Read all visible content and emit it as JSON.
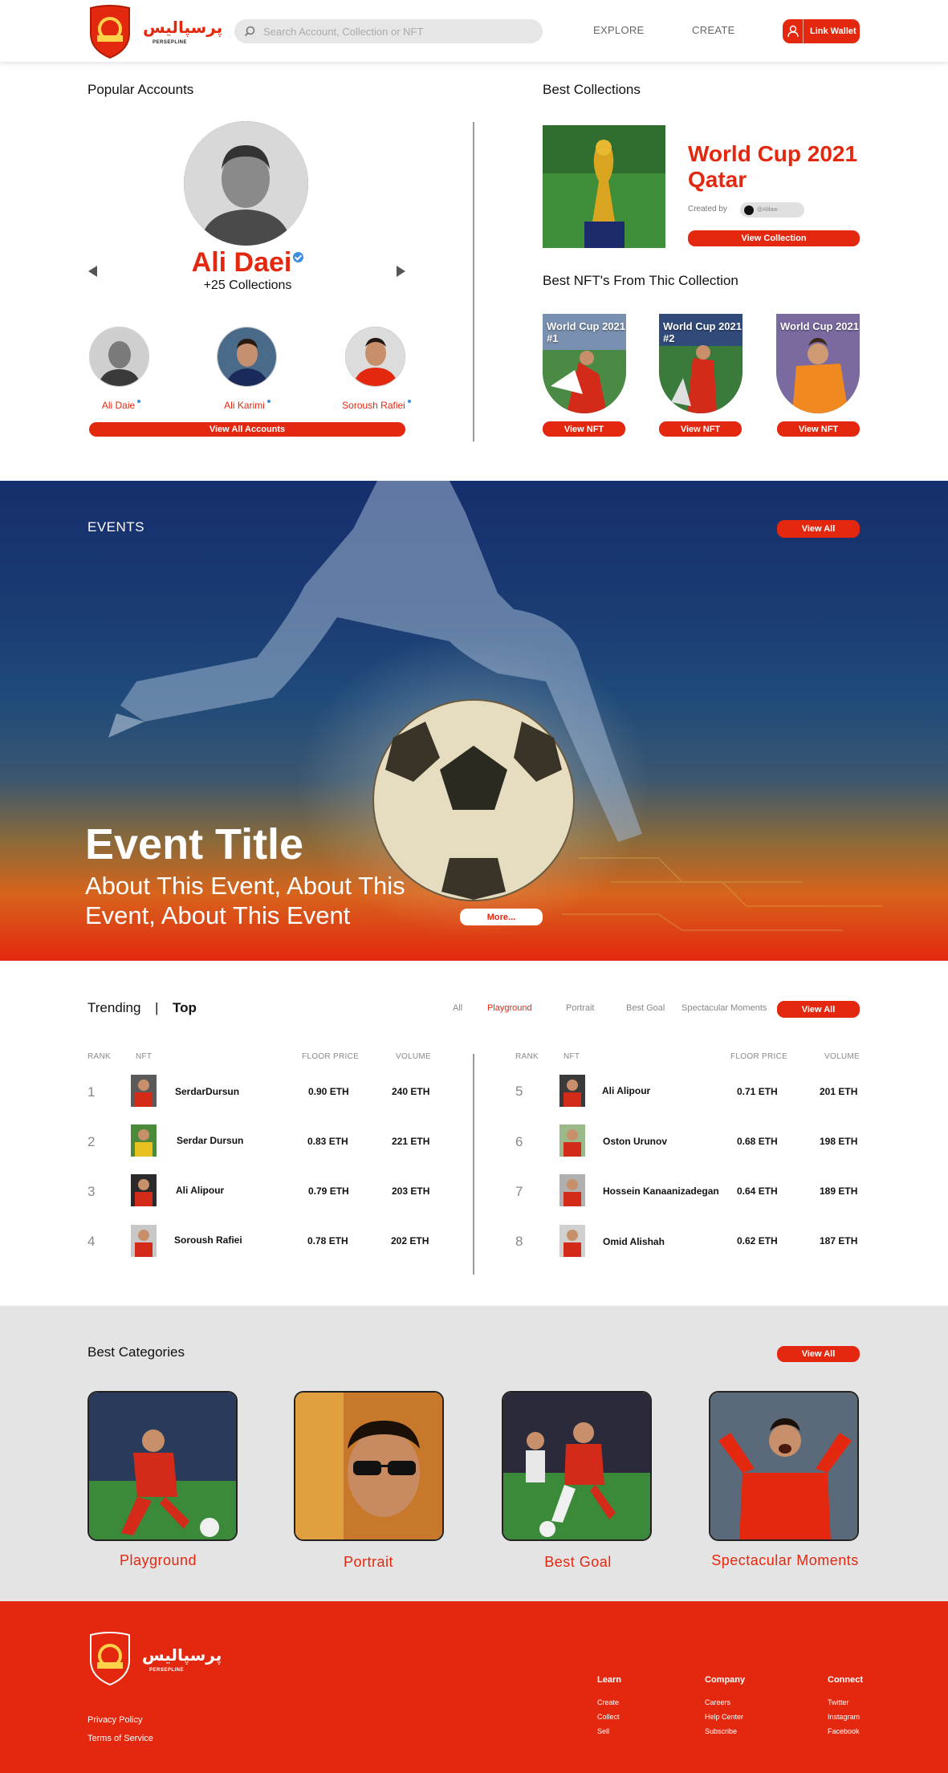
{
  "header": {
    "logo_text": "پرسپالیس",
    "logo_sub": "PERSEPLINE",
    "search_placeholder": "Search Account, Collection or NFT",
    "nav": [
      "EXPLORE",
      "CREATE"
    ],
    "wallet_label": "Link Wallet"
  },
  "popular": {
    "title": "Popular Accounts",
    "featured_name": "Ali Daei",
    "featured_collections": "+25 Collections",
    "accounts": [
      "Ali Daie",
      "Ali Karimi",
      "Soroush Rafiei"
    ],
    "view_all": "View All Accounts"
  },
  "collections": {
    "title": "Best Collections",
    "featured_title": "World Cup 2021 Qatar",
    "created_by": "Created by",
    "creator": "@Alilaw",
    "view_collection": "View Collection",
    "nft_title": "Best NFT's From Thic Collection",
    "nfts": [
      {
        "label": "World Cup 2021 #1",
        "button": "View NFT"
      },
      {
        "label": "World Cup 2021 #2",
        "button": "View NFT"
      },
      {
        "label": "World Cup 2021",
        "button": "View NFT"
      }
    ]
  },
  "events": {
    "label": "EVENTS",
    "view_all": "View All",
    "title": "Event Title",
    "description": "About This Event, About This Event, About This Event",
    "more": "More..."
  },
  "trending": {
    "tab_trending": "Trending",
    "separator": "|",
    "tab_top": "Top",
    "filters": [
      "All",
      "Playground",
      "Portrait",
      "Best Goal",
      "Spectacular Moments"
    ],
    "active_filter": "Playground",
    "view_all": "View All",
    "headers": {
      "rank": "RANK",
      "nft": "NFT",
      "floor": "FLOOR PRICE",
      "volume": "VOLUME"
    },
    "rows": [
      {
        "rank": "1",
        "name": "SerdarDursun",
        "floor": "0.90 ETH",
        "volume": "240 ETH"
      },
      {
        "rank": "2",
        "name": "Serdar Dursun",
        "floor": "0.83 ETH",
        "volume": "221 ETH"
      },
      {
        "rank": "3",
        "name": "Ali Alipour",
        "floor": "0.79 ETH",
        "volume": "203 ETH"
      },
      {
        "rank": "4",
        "name": "Soroush Rafiei",
        "floor": "0.78 ETH",
        "volume": "202 ETH"
      },
      {
        "rank": "5",
        "name": "Ali Alipour",
        "floor": "0.71 ETH",
        "volume": "201 ETH"
      },
      {
        "rank": "6",
        "name": "Oston Urunov",
        "floor": "0.68 ETH",
        "volume": "198 ETH"
      },
      {
        "rank": "7",
        "name": "Hossein Kanaanizadegan",
        "floor": "0.64 ETH",
        "volume": "189 ETH"
      },
      {
        "rank": "8",
        "name": "Omid Alishah",
        "floor": "0.62 ETH",
        "volume": "187 ETH"
      }
    ]
  },
  "categories": {
    "title": "Best Categories",
    "view_all": "View All",
    "items": [
      "Playground",
      "Portrait",
      "Best Goal",
      "Spectacular Moments"
    ]
  },
  "footer": {
    "logo_text": "پرسپالیس",
    "logo_sub": "PERSEPLINE",
    "columns": [
      {
        "head": "Learn",
        "links": [
          "Create",
          "Collect",
          "Sell"
        ]
      },
      {
        "head": "Company",
        "links": [
          "Careers",
          "Help Center",
          "Subscribe"
        ]
      },
      {
        "head": "Connect",
        "links": [
          "Twitter",
          "Instagram",
          "Facebook"
        ]
      }
    ],
    "privacy": "Privacy Policy",
    "terms": "Terms of Service"
  },
  "colors": {
    "accent": "#e3280f",
    "verified": "#3b8de0",
    "events_top": "#162f6e"
  }
}
